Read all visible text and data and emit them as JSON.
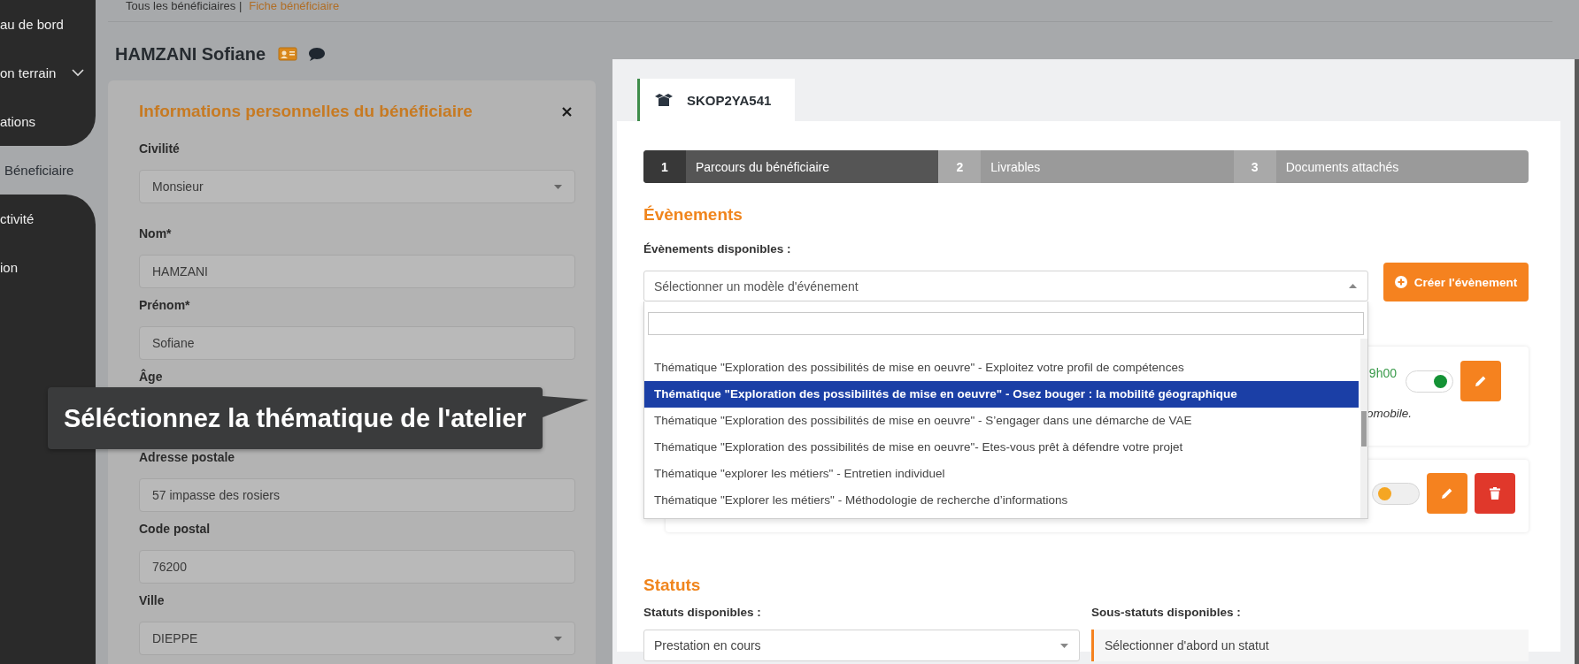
{
  "sidebar": {
    "items": [
      {
        "label": "au de bord",
        "selected": false,
        "submenu": false
      },
      {
        "label": "on terrain",
        "selected": false,
        "submenu": true
      },
      {
        "label": "ations",
        "selected": false,
        "submenu": false
      },
      {
        "label": "Béneficiaire",
        "selected": true,
        "submenu": false
      },
      {
        "label": "ctivité",
        "selected": false,
        "submenu": false
      },
      {
        "label": "ion",
        "selected": false,
        "submenu": false
      }
    ]
  },
  "breadcrumb": {
    "parent": "Tous les bénéficiaires |",
    "current": "Fiche bénéficiaire"
  },
  "page_title": "HAMZANI Sofiane",
  "personal_card": {
    "title": "Informations personnelles du bénéficiaire",
    "fields": [
      {
        "label": "Civilité",
        "kind": "select",
        "value": "Monsieur"
      },
      {
        "label": "Nom*",
        "kind": "text",
        "value": "HAMZANI"
      },
      {
        "label": "Prénom*",
        "kind": "text",
        "value": "Sofiane"
      },
      {
        "label": "Âge",
        "kind": "hidden"
      },
      {
        "label": "Adresse postale",
        "kind": "text",
        "value": "57 impasse des rosiers"
      },
      {
        "label": "Code postal",
        "kind": "text",
        "value": "76200"
      },
      {
        "label": "Ville",
        "kind": "select",
        "value": "DIEPPE"
      }
    ]
  },
  "tooltip": {
    "text": "Séléctionnez la thématique de l'atelier"
  },
  "modal": {
    "tab": {
      "label": "SKOP2YA541"
    },
    "steps": [
      {
        "number": "1",
        "label": "Parcours du bénéficiaire",
        "selected": true
      },
      {
        "number": "2",
        "label": "Livrables",
        "selected": false
      },
      {
        "number": "3",
        "label": "Documents attachés",
        "selected": false
      }
    ],
    "events": {
      "title": "Évènements",
      "label": "Évènements disponibles :",
      "select": {
        "placeholder": "Sélectionner un modèle d'événement",
        "expanded": true
      },
      "create_button": "Créer l'évènement",
      "options": [
        {
          "label": "Thématique \"Exploration des possibilités de mise en oeuvre\" - Exploitez votre profil de compétences",
          "selected": false
        },
        {
          "label": "Thématique \"Exploration des possibilités de mise en oeuvre\" - Osez bouger : la mobilité géographique",
          "selected": true
        },
        {
          "label": "Thématique \"Exploration des possibilités de mise en oeuvre\" - S’engager dans une démarche de VAE",
          "selected": false
        },
        {
          "label": "Thématique \"Exploration des possibilités de mise en oeuvre\"- Etes-vous prêt à défendre votre projet",
          "selected": false
        },
        {
          "label": "Thématique \"explorer les métiers\" - Entretien individuel",
          "selected": false
        },
        {
          "label": "Thématique \"Explorer les métiers\" - Méthodologie de recherche d’informations",
          "selected": false
        }
      ],
      "cards": [
        {
          "time": "9h00",
          "note": "omobile.",
          "on": true,
          "deletable": false
        },
        {
          "on": false,
          "deletable": true
        }
      ]
    },
    "statuts": {
      "title": "Statuts",
      "label": "Statuts disponibles :",
      "select": {
        "value": "Prestation en cours",
        "expanded": false
      },
      "sub_label": "Sous-statuts disponibles :",
      "sub_hint": "Sélectionner d'abord un statut"
    }
  }
}
